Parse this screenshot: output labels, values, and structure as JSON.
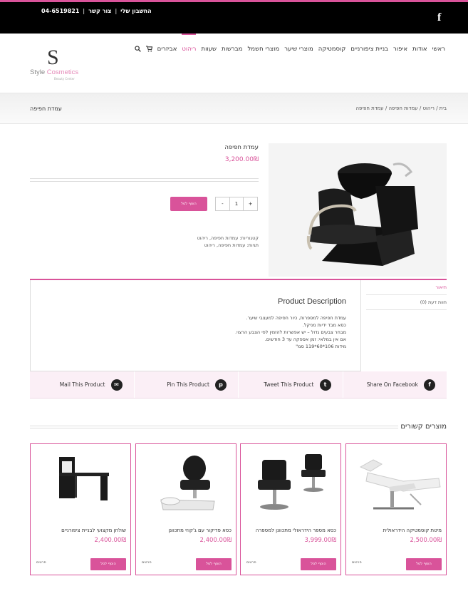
{
  "topbar": {
    "phone": "04-6519821",
    "contact": "צור קשר",
    "account": "החשבון שלי",
    "separator": "|",
    "facebook_glyph": "f"
  },
  "logo": {
    "mark": "S",
    "name_part1": "Style",
    "name_part2": "Cosmetics",
    "sub": "Beauty Center"
  },
  "nav": {
    "items": [
      "ראשי",
      "אודות",
      "איפור",
      "בניית ציפורניים",
      "קוסמטיקה",
      "מוצרי שיער",
      "מוצרי חשמל",
      "מברשות",
      "שעוות",
      "ריהוט",
      "אביזרים"
    ],
    "active": "ריהוט",
    "cart_icon": "cart-icon",
    "search_icon": "search-icon"
  },
  "titlebar": {
    "title": "עמדת חפיפה",
    "breadcrumb": "בית / ריהוט / עמדות חפיפה / עמדת חפיפה"
  },
  "product": {
    "title": "עמדת חפיפה",
    "price": "3,200.00₪",
    "qty_minus": "-",
    "qty_value": "1",
    "qty_plus": "+",
    "add_to_cart": "הוסף לסל",
    "categories": "קטגוריות: עמדות חפיפה, ריהוט",
    "tags": "תגיות: עמדות חפיפה, ריהוט"
  },
  "tabs": {
    "description_tab": "תיאור",
    "reviews_tab": "חוות דעת (0)",
    "heading": "Product Description",
    "lines": [
      "עמדת חפיפה למספרות, כיור חפיפה למעצבי שיער.",
      "כסא מבד ידיות מניקל.",
      "מבחר צבעים גדול – יש אפשרות להזמין לפי הצבע הרצוי.",
      "אם אין במלאי: זמן אספקה עד 3 חודשים.",
      "מידות 106*60*119 סמ\""
    ]
  },
  "share": [
    {
      "label": "Share On Facebook",
      "glyph": "f",
      "icon": "facebook-icon"
    },
    {
      "label": "Tweet This Product",
      "glyph": "t",
      "icon": "twitter-icon"
    },
    {
      "label": "Pin This Product",
      "glyph": "p",
      "icon": "pinterest-icon"
    },
    {
      "label": "Mail This Product",
      "glyph": "✉",
      "icon": "mail-icon"
    }
  ],
  "related": {
    "title": "מוצרים קשורים",
    "button": "הוסף לסל",
    "details": "פרטים",
    "items": [
      {
        "name": "מיטת קוסמטיקה הידראולית",
        "price": "2,500.00₪"
      },
      {
        "name": "כסא מספר הידראולי מתכוונן למספרה",
        "price": "3,999.00₪"
      },
      {
        "name": "כסא פדיקור עם ג'קוזי מתכוונן",
        "price": "2,400.00₪"
      },
      {
        "name": "שולחן מקצועי לבניית ציפורניים",
        "price": "2,400.00₪"
      }
    ]
  },
  "colors": {
    "accent": "#d9539a",
    "topbar": "#000000"
  }
}
